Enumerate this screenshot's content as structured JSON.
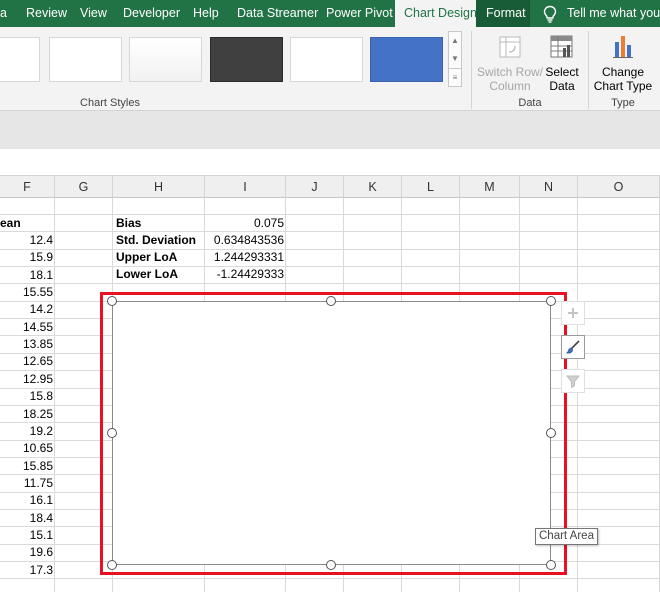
{
  "ribbon": {
    "tabs": [
      {
        "label": "a"
      },
      {
        "label": "Review"
      },
      {
        "label": "View"
      },
      {
        "label": "Developer"
      },
      {
        "label": "Help"
      },
      {
        "label": "Data Streamer"
      },
      {
        "label": "Power Pivot"
      },
      {
        "label": "Chart Design"
      },
      {
        "label": "Format"
      }
    ],
    "active_tab": "Chart Design",
    "tell_me": "Tell me what you w",
    "groups": {
      "chart_styles": {
        "label": "Chart Styles"
      },
      "data": {
        "label": "Data",
        "switch_row_column": "Switch Row/ Column",
        "select_data": "Select Data"
      },
      "type": {
        "label": "Type",
        "change_chart_type": "Change Chart Type"
      }
    },
    "colors": {
      "tab_bar": "#217346",
      "format_tab": "#185c37",
      "style_dark": "#404040",
      "style_blue": "#4472c4"
    }
  },
  "sheet": {
    "columns": [
      "F",
      "G",
      "H",
      "I",
      "J",
      "K",
      "L",
      "M",
      "N",
      "O"
    ],
    "mean_header": "ean",
    "mean_values": [
      "12.4",
      "15.9",
      "18.1",
      "15.55",
      "14.2",
      "14.55",
      "13.85",
      "12.65",
      "12.95",
      "15.8",
      "18.25",
      "19.2",
      "10.65",
      "15.85",
      "11.75",
      "16.1",
      "18.4",
      "15.1",
      "19.6",
      "17.3"
    ],
    "stats": [
      {
        "label": "Bias",
        "value": "0.075"
      },
      {
        "label": "Std. Deviation",
        "value": "0.634843536"
      },
      {
        "label": "Upper LoA",
        "value": "1.244293331"
      },
      {
        "label": "Lower LoA",
        "value": "-1.24429333"
      }
    ]
  },
  "chart": {
    "tooltip": "Chart Area",
    "selection_color": "#e81123",
    "side_buttons": [
      "chart-elements-plus-icon",
      "chart-styles-brush-icon",
      "chart-filters-funnel-icon"
    ]
  }
}
